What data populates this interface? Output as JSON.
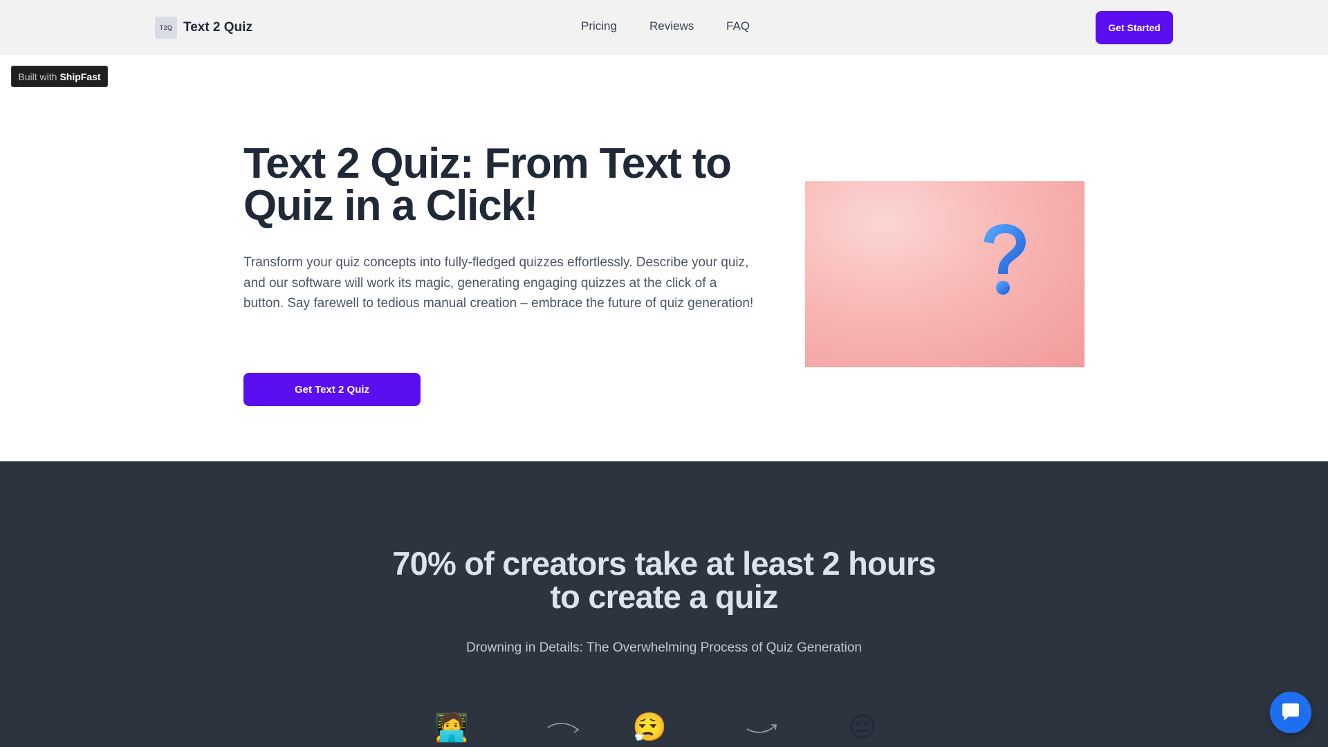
{
  "header": {
    "logo_text": "T2Q",
    "brand_name": "Text 2 Quiz",
    "nav": [
      "Pricing",
      "Reviews",
      "FAQ"
    ],
    "cta_label": "Get Started"
  },
  "badge": {
    "prefix": "Built with",
    "name": "ShipFast"
  },
  "hero": {
    "title": "Text 2 Quiz: From Text to Quiz in a Click!",
    "description": "Transform your quiz concepts into fully-fledged quizzes effortlessly. Describe your quiz, and our software will work its magic, generating engaging quizzes at the click of a button. Say farewell to tedious manual creation – embrace the future of quiz generation!",
    "cta_label": "Get Text 2 Quiz",
    "image_icon": "question-mark-icon"
  },
  "problem": {
    "title": "70% of creators take at least 2 hours to create a quiz",
    "subtitle": "Drowning in Details: The Overwhelming Process of Quiz Generation",
    "steps": [
      "🧑‍💻",
      "😮‍💨",
      "😔"
    ]
  },
  "chat": {
    "icon": "chat-bubble-icon"
  },
  "colors": {
    "primary": "#5b0ff0",
    "dark_bg": "#2c3440",
    "chat": "#1e6ff0"
  }
}
